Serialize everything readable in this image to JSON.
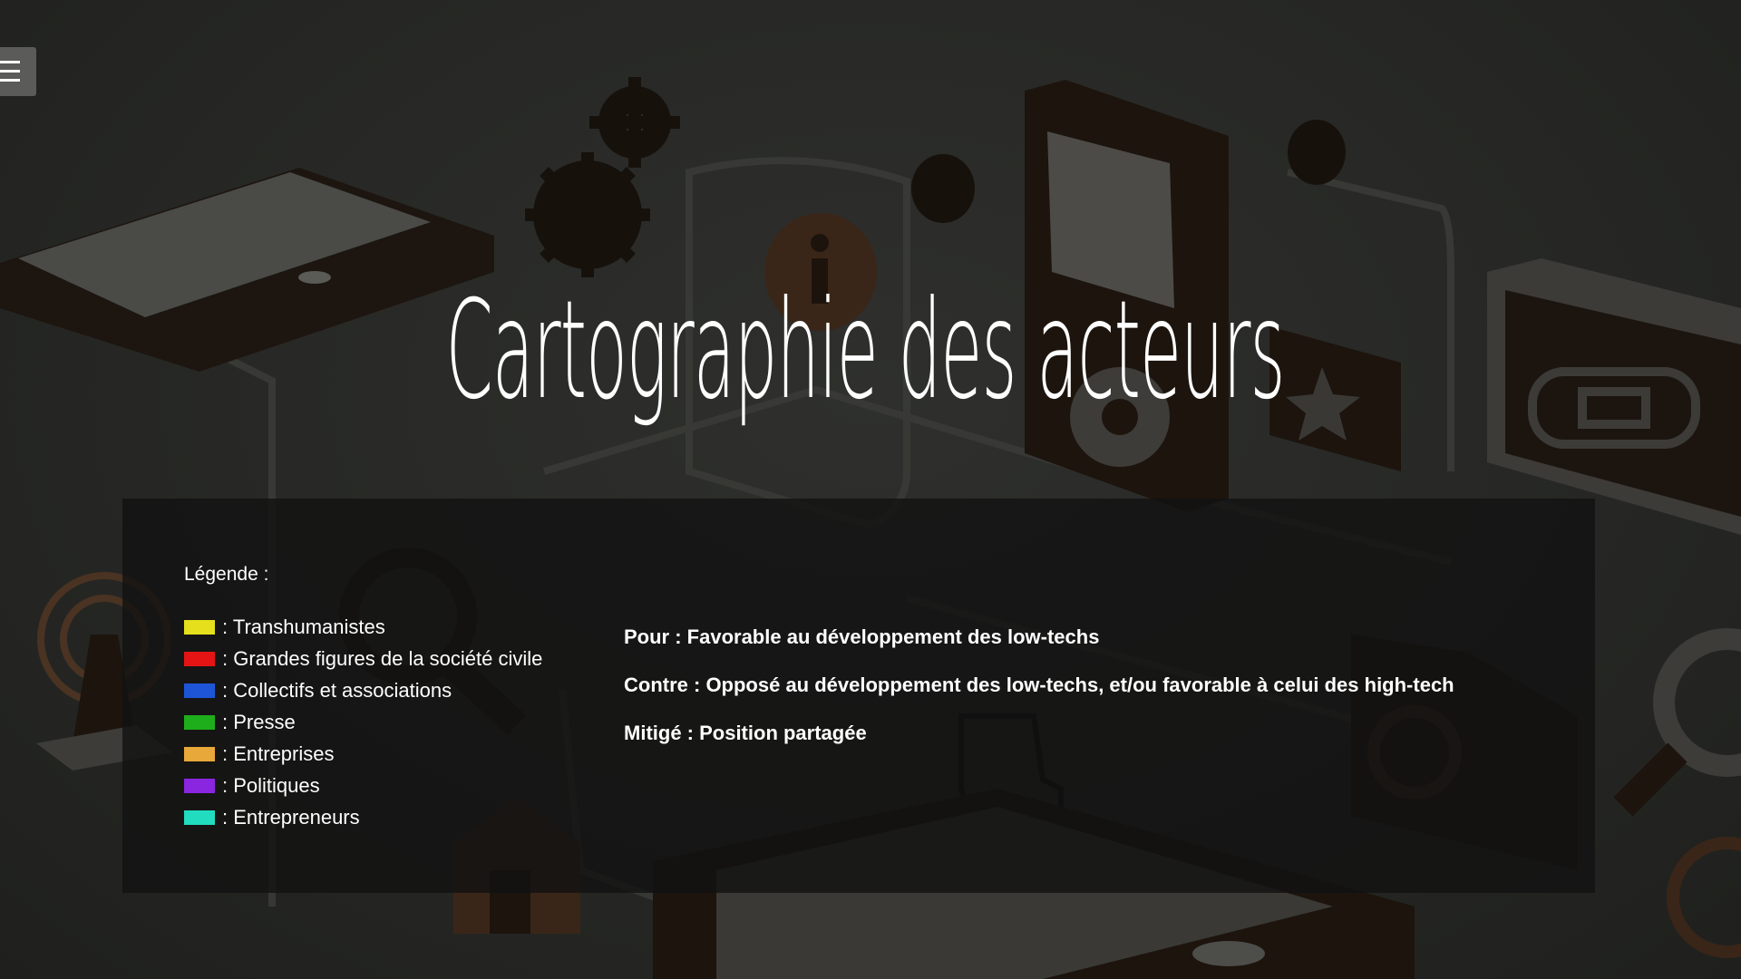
{
  "page": {
    "title": "Cartographie des acteurs"
  },
  "menu": {
    "icon": "hamburger-menu-icon"
  },
  "legend": {
    "title": "Légende :",
    "items": [
      {
        "label": ": Transhumanistes",
        "color": "#e5e01b"
      },
      {
        "label": ": Grandes figures de la société civile",
        "color": "#e41414"
      },
      {
        "label": ": Collectifs et associations",
        "color": "#1d55d6"
      },
      {
        "label": ": Presse",
        "color": "#1fae1b"
      },
      {
        "label": ": Entreprises",
        "color": "#e8a93a"
      },
      {
        "label": ": Politiques",
        "color": "#8a25e0"
      },
      {
        "label": ": Entrepreneurs",
        "color": "#22dcc0"
      }
    ]
  },
  "positions": [
    {
      "text": "Pour : Favorable au développement des low-techs"
    },
    {
      "text": "Contre : Opposé au développement des low-techs, et/ou favorable à celui des high-tech"
    },
    {
      "text": "Mitigé : Position partagée"
    }
  ],
  "background": {
    "icons": [
      "tablet-icon",
      "gear-icon",
      "info-icon",
      "media-player-icon",
      "headphones-icon",
      "camera-icon",
      "cassette-icon",
      "star-icon",
      "search-icon",
      "antenna-icon",
      "hand-cursor-icon",
      "at-sign-icon",
      "house-icon",
      "power-icon"
    ]
  }
}
